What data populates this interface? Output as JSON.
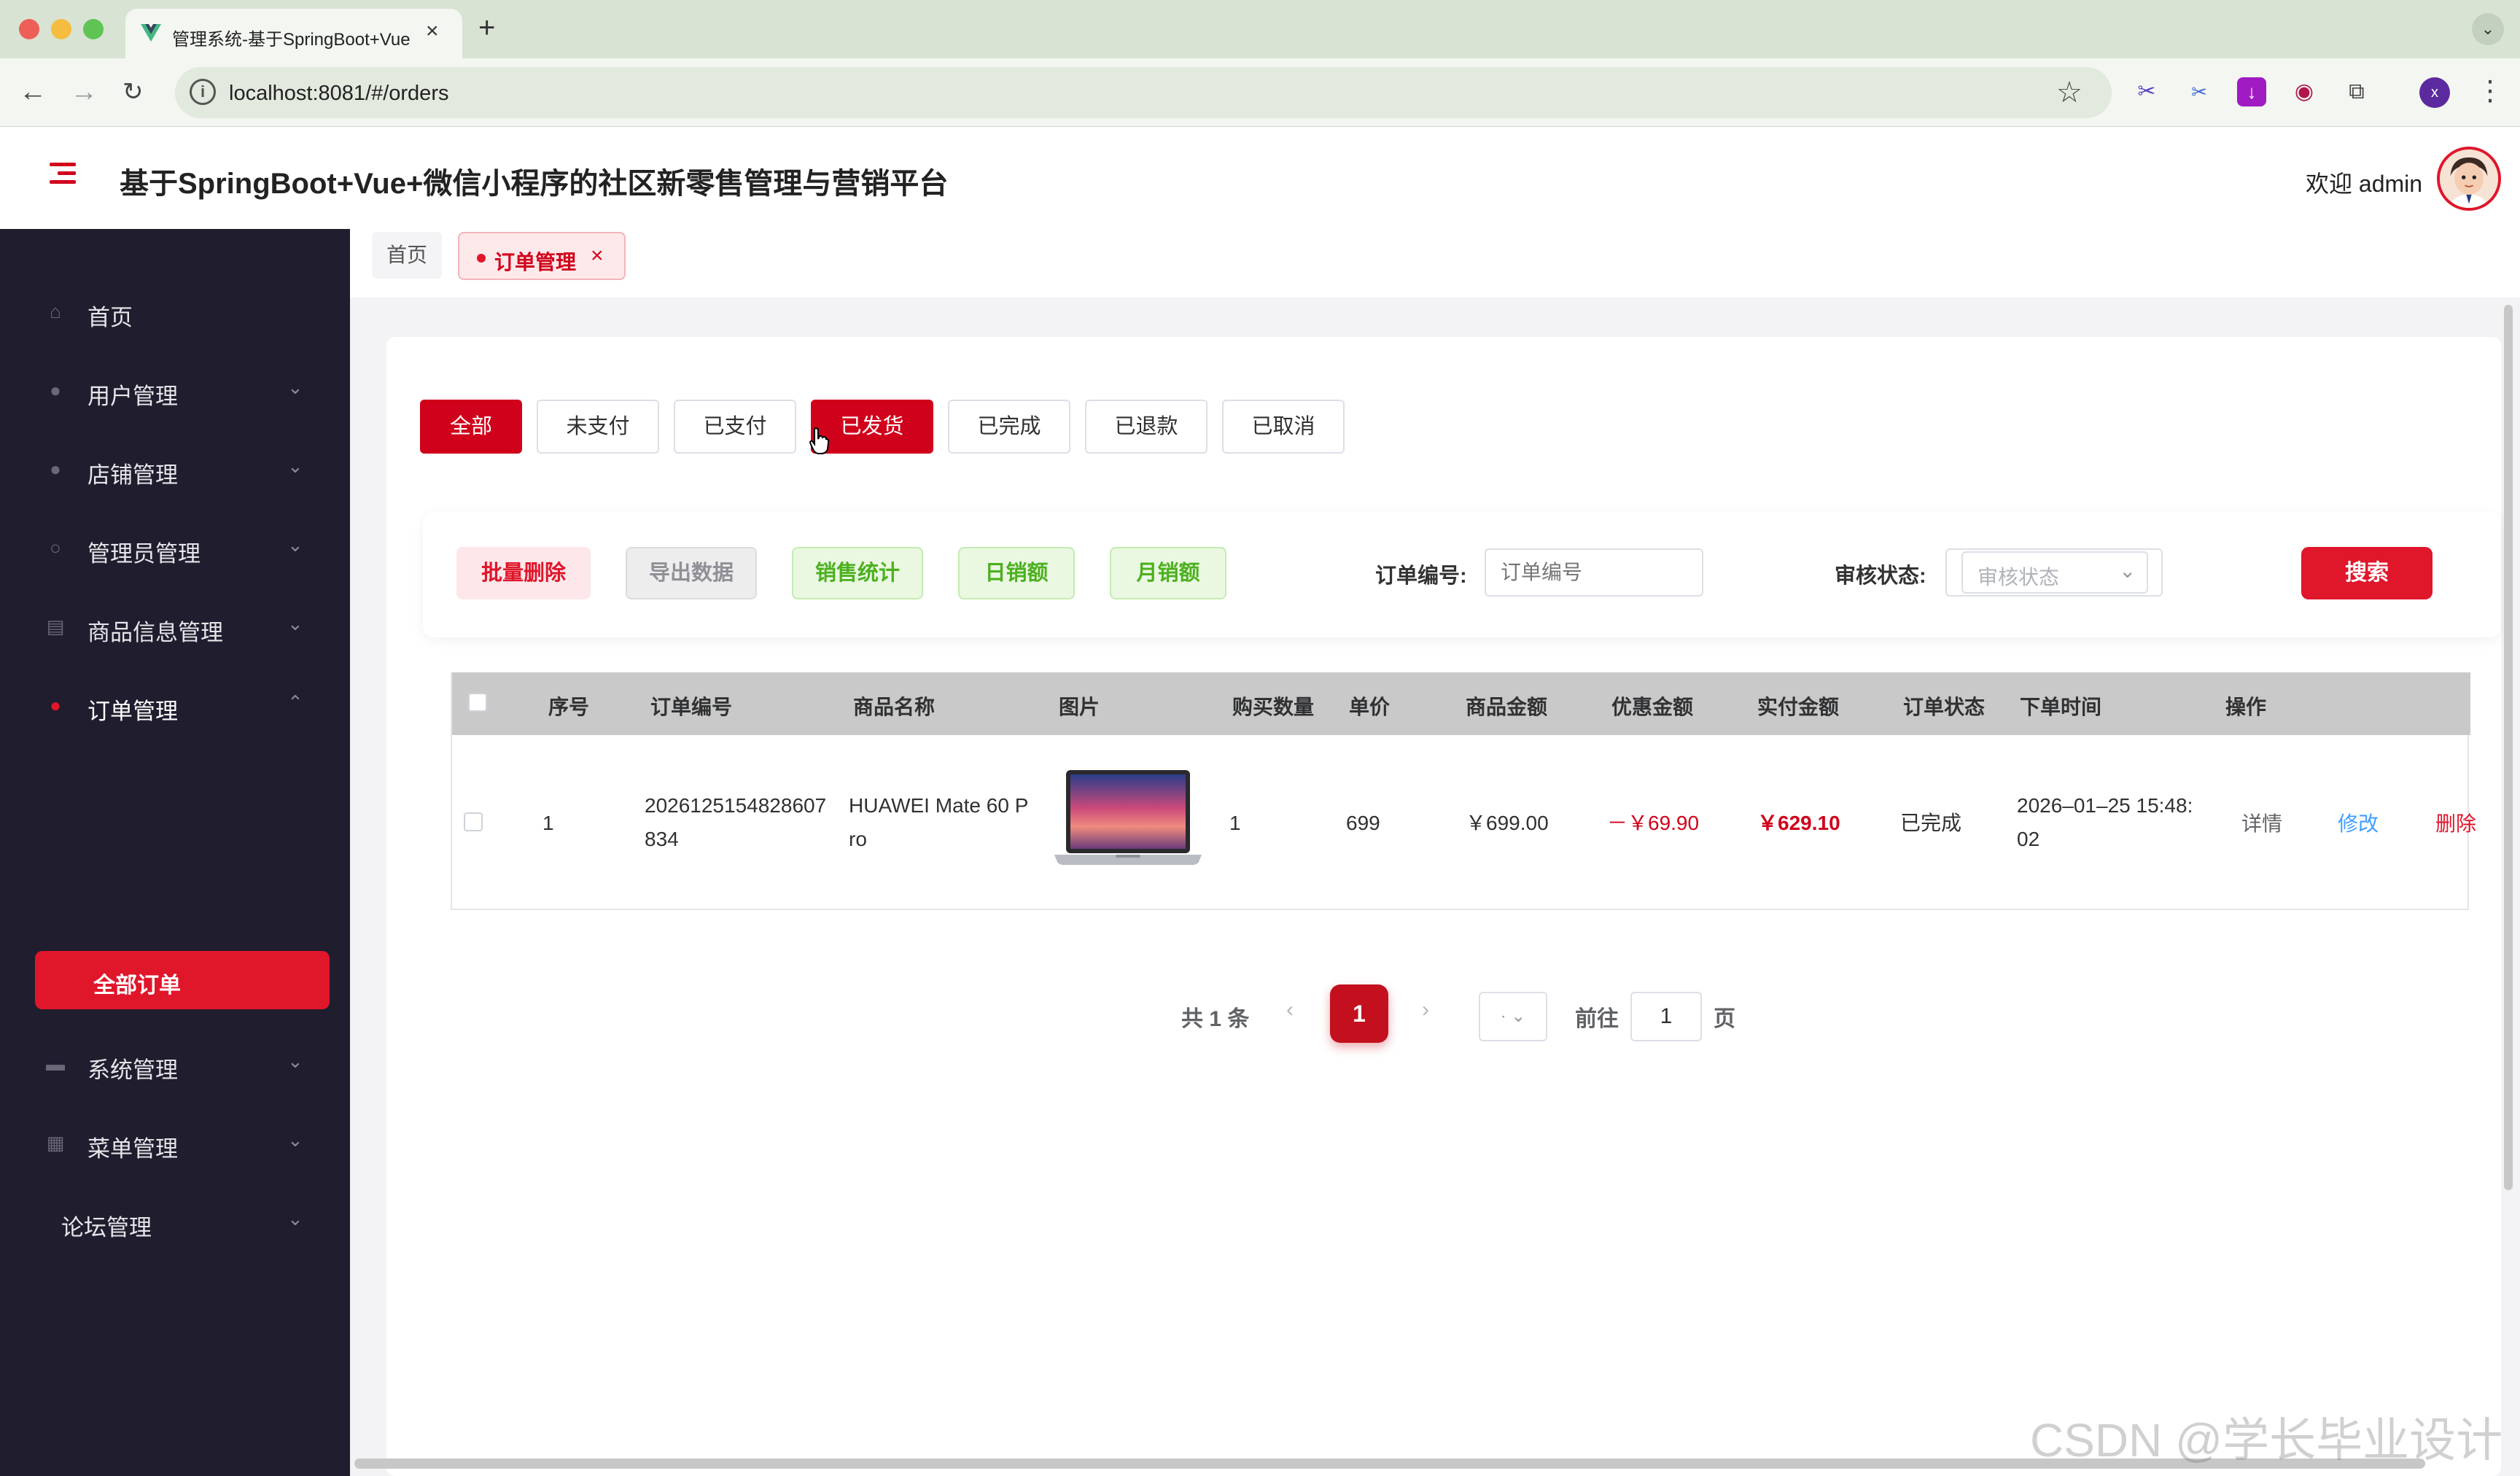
{
  "browser": {
    "tab_title": "管理系统-基于SpringBoot+Vue",
    "url": "localhost:8081/#/orders",
    "profile_initial": "x"
  },
  "header": {
    "title": "基于SpringBoot+Vue+微信小程序的社区新零售管理与营销平台",
    "welcome": "欢迎 admin"
  },
  "sidebar": {
    "items": [
      {
        "label": "首页",
        "icon": "home-icon"
      },
      {
        "label": "用户管理",
        "icon": "user-icon"
      },
      {
        "label": "店铺管理",
        "icon": "user-icon"
      },
      {
        "label": "管理员管理",
        "icon": "user-outline-icon"
      },
      {
        "label": "商品信息管理",
        "icon": "list-icon"
      },
      {
        "label": "订单管理",
        "icon": "order-icon"
      },
      {
        "label": "系统管理",
        "icon": "system-icon"
      },
      {
        "label": "菜单管理",
        "icon": "menu-grid-icon"
      },
      {
        "label": "论坛管理",
        "icon": ""
      }
    ],
    "active_sub": "全部订单"
  },
  "breadcrumb": {
    "home": "首页",
    "active": "订单管理",
    "close": "×"
  },
  "status_filters": [
    "全部",
    "未支付",
    "已支付",
    "已发货",
    "已完成",
    "已退款",
    "已取消"
  ],
  "actions": {
    "batch_delete": "批量删除",
    "export": "导出数据",
    "sales_stats": "销售统计",
    "daily_sales": "日销额",
    "monthly_sales": "月销额"
  },
  "search": {
    "order_no_label": "订单编号:",
    "order_no_placeholder": "订单编号",
    "review_label": "审核状态:",
    "review_placeholder": "审核状态",
    "button": "搜索"
  },
  "table": {
    "columns": [
      "序号",
      "订单编号",
      "商品名称",
      "图片",
      "购买数量",
      "单价",
      "商品金额",
      "优惠金额",
      "实付金额",
      "订单状态",
      "下单时间",
      "操作"
    ],
    "rows": [
      {
        "index": "1",
        "order_no_line1": "2026125154828607",
        "order_no_line2": "834",
        "product_line1": "HUAWEI Mate 60 P",
        "product_line2": "ro",
        "quantity": "1",
        "unit_price": "699",
        "amount": "￥699.00",
        "discount": "－￥69.90",
        "paid": "￥629.10",
        "status": "已完成",
        "time_line1": "2026–01–25 15:48:",
        "time_line2": "02",
        "op_detail": "详情",
        "op_edit": "修改",
        "op_delete": "删除"
      }
    ]
  },
  "pagination": {
    "total": "共 1 条",
    "current_page": "1",
    "goto_label": "前往",
    "goto_value": "1",
    "page_suffix": "页"
  },
  "watermark": "CSDN @学长毕业设计",
  "colors": {
    "primary": "#d0021b",
    "sidebar_bg": "#1f1d2e",
    "link_blue": "#409eff",
    "success_green": "#4cb01e"
  }
}
